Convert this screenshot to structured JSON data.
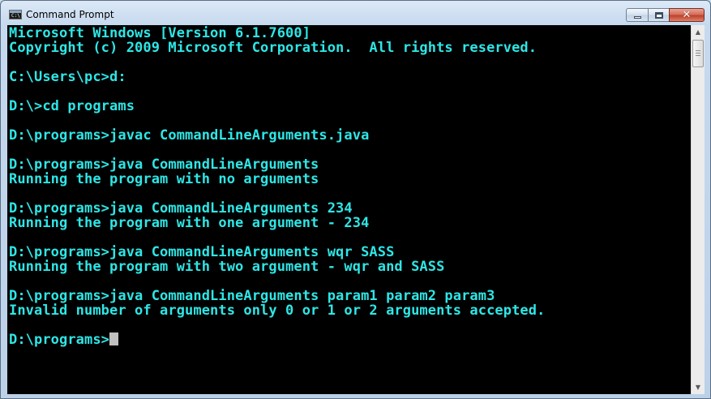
{
  "window": {
    "title": "Command Prompt",
    "icon": "cmd-app-icon",
    "icon_text": "C:\\",
    "caption_buttons": {
      "minimize_icon": "minimize-icon",
      "maximize_icon": "maximize-icon",
      "close_icon": "close-icon",
      "close_glyph": "✕"
    }
  },
  "console": {
    "text_color": "#2ee6e6",
    "background": "#000000",
    "lines": [
      "Microsoft Windows [Version 6.1.7600]",
      "Copyright (c) 2009 Microsoft Corporation.  All rights reserved.",
      "",
      "C:\\Users\\pc>d:",
      "",
      "D:\\>cd programs",
      "",
      "D:\\programs>javac CommandLineArguments.java",
      "",
      "D:\\programs>java CommandLineArguments",
      "Running the program with no arguments",
      "",
      "D:\\programs>java CommandLineArguments 234",
      "Running the program with one argument - 234",
      "",
      "D:\\programs>java CommandLineArguments wqr SASS",
      "Running the program with two argument - wqr and SASS",
      "",
      "D:\\programs>java CommandLineArguments param1 param2 param3",
      "Invalid number of arguments only 0 or 1 or 2 arguments accepted.",
      "",
      "D:\\programs>"
    ]
  },
  "scrollbar": {
    "up_icon": "scroll-up-arrow-icon",
    "down_icon": "scroll-down-arrow-icon",
    "up_glyph": "▲",
    "down_glyph": "▼",
    "position": 0
  }
}
